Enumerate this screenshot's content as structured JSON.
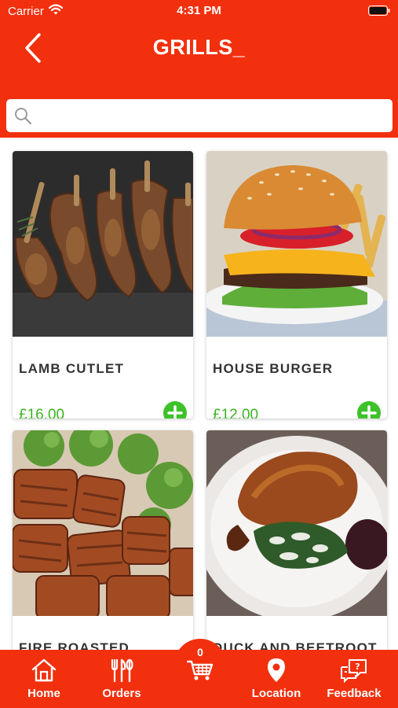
{
  "status_bar": {
    "carrier": "Carrier",
    "time": "4:31 PM"
  },
  "header": {
    "title": "GRILLS_",
    "back_icon": "chevron-left-icon"
  },
  "search": {
    "placeholder": "",
    "value": "",
    "icon": "search-icon"
  },
  "products": [
    {
      "name": "LAMB CUTLET",
      "price": "£16.00"
    },
    {
      "name": "HOUSE BURGER",
      "price": "£12.00"
    },
    {
      "name": "FIRE ROASTED CHICKEN",
      "price": ""
    },
    {
      "name": "DUCK AND BEETROOT",
      "price": ""
    }
  ],
  "tab_bar": {
    "home": "Home",
    "orders": "Orders",
    "cart_count": "0",
    "location": "Location",
    "feedback": "Feedback"
  },
  "colors": {
    "brand_red": "#f2300e",
    "price_green": "#3cb521",
    "add_button_green": "#3dc22a",
    "text_dark": "#333333"
  }
}
